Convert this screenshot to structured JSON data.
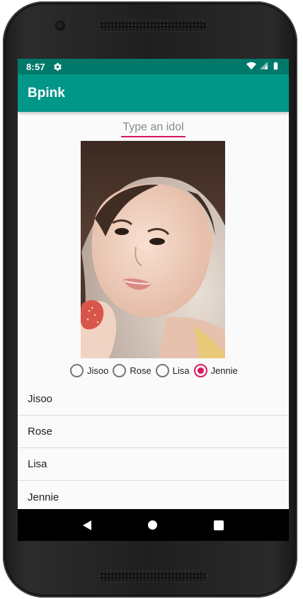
{
  "status_bar": {
    "time": "8:57",
    "icons": [
      "gear-icon",
      "wifi-icon",
      "signal-icon",
      "battery-icon"
    ]
  },
  "app_bar": {
    "title": "Bpink"
  },
  "search": {
    "placeholder": "Type an idol",
    "value": ""
  },
  "photo": {
    "description_icon": "idol-photo"
  },
  "radio_group": {
    "options": [
      "Jisoo",
      "Rose",
      "Lisa",
      "Jennie"
    ],
    "selected": "Jennie"
  },
  "list": {
    "items": [
      "Jisoo",
      "Rose",
      "Lisa",
      "Jennie"
    ]
  },
  "nav_bar": {
    "icons": [
      "back-icon",
      "home-icon",
      "recents-icon"
    ]
  },
  "colors": {
    "status_bar": "#00796b",
    "app_bar": "#009688",
    "accent": "#d81b60",
    "nav_bar": "#000000"
  }
}
